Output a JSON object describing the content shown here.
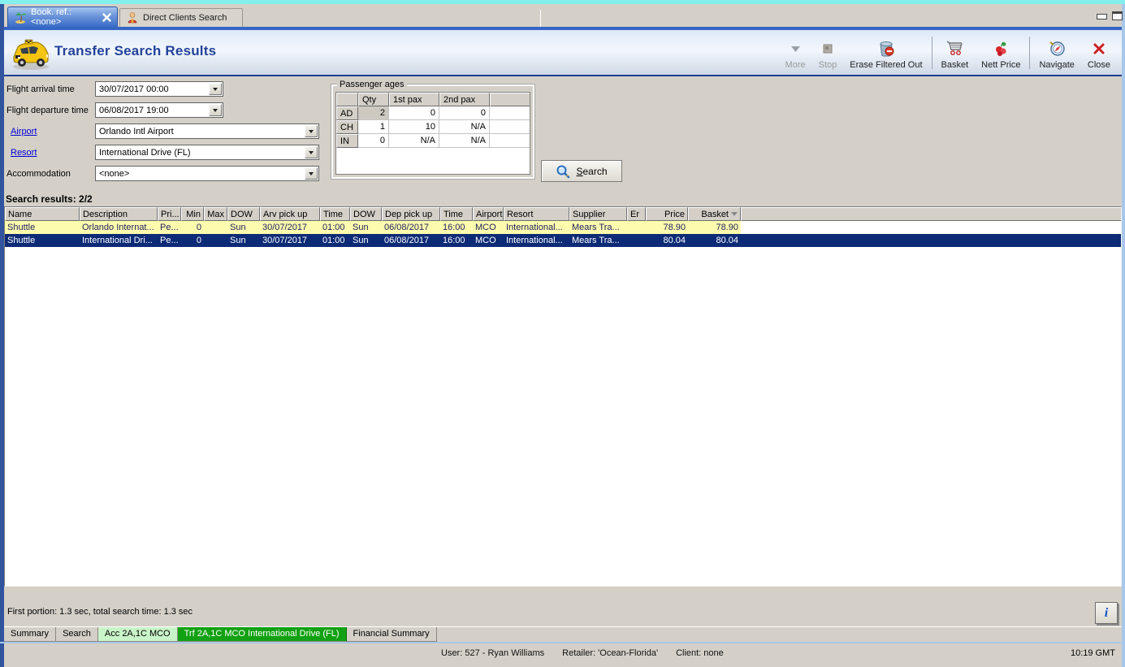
{
  "top_tabs": {
    "booking_tab": {
      "label": "Book. ref.: <none>",
      "icon": "palm-tree"
    },
    "direct_clients_tab": {
      "label": "Direct Clients Search",
      "icon": "person"
    }
  },
  "header": {
    "title": "Transfer Search Results",
    "toolbar": {
      "more": "More",
      "stop": "Stop",
      "erase": "Erase Filtered Out",
      "basket": "Basket",
      "nett_price": "Nett Price",
      "navigate": "Navigate",
      "close": "Close"
    }
  },
  "form": {
    "flight_arrival": {
      "label": "Flight arrival time",
      "value": "30/07/2017 00:00"
    },
    "flight_departure": {
      "label": "Flight departure time",
      "value": "06/08/2017 19:00"
    },
    "airport": {
      "label": "Airport",
      "value": "Orlando Intl Airport"
    },
    "resort": {
      "label": "Resort",
      "value": "International Drive (FL)"
    },
    "accommodation": {
      "label": "Accommodation",
      "value": "<none>"
    }
  },
  "passenger_ages": {
    "title": "Passenger ages",
    "columns": [
      "",
      "Qty",
      "1st pax",
      "2nd pax"
    ],
    "rows": [
      {
        "label": "AD",
        "qty": "2",
        "pax1": "0",
        "pax2": "0"
      },
      {
        "label": "CH",
        "qty": "1",
        "pax1": "10",
        "pax2": "N/A"
      },
      {
        "label": "IN",
        "qty": "0",
        "pax1": "N/A",
        "pax2": "N/A"
      }
    ]
  },
  "search_button": {
    "underlined": "S",
    "rest": "earch"
  },
  "results": {
    "label": "Search results: 2/2",
    "columns": [
      "Name",
      "Description",
      "Pri...",
      "Min",
      "Max",
      "DOW",
      "Arv pick up",
      "Time",
      "DOW",
      "Dep pick up",
      "Time",
      "Airport",
      "Resort",
      "Supplier",
      "Er",
      "Price",
      "Basket"
    ],
    "rows": [
      {
        "cells": [
          "Shuttle",
          "Orlando Internat...",
          "Pe...",
          "0",
          "",
          "Sun",
          "30/07/2017",
          "01:00",
          "Sun",
          "06/08/2017",
          "16:00",
          "MCO",
          "International...",
          "Mears Tra...",
          "",
          "78.90",
          "78.90"
        ]
      },
      {
        "cells": [
          "Shuttle",
          "International Dri...",
          "Pe...",
          "0",
          "",
          "Sun",
          "30/07/2017",
          "01:00",
          "Sun",
          "06/08/2017",
          "16:00",
          "MCO",
          "International...",
          "Mears Tra...",
          "",
          "80.04",
          "80.04"
        ]
      }
    ]
  },
  "status_line": "First portion: 1.3 sec, total search time: 1.3 sec",
  "info_button": "i",
  "bottom_tabs": [
    "Summary",
    "Search",
    "Acc 2A,1C MCO",
    "Trf 2A,1C MCO International Drive (FL)",
    "Financial Summary"
  ],
  "status_bar": {
    "user": "User: 527 - Ryan Williams",
    "retailer": "Retailer: 'Ocean-Florida'",
    "client": "Client: none",
    "time": "10:19 GMT"
  },
  "colors": {
    "accent_blue": "#3566c4",
    "title_navy": "#23429a",
    "row_highlight_yellow": "#fdfcae",
    "row_selected_navy": "#0c2a75",
    "active_bottom_tab_green": "#12a112",
    "pale_bottom_tab_green": "#c9f4c9"
  }
}
